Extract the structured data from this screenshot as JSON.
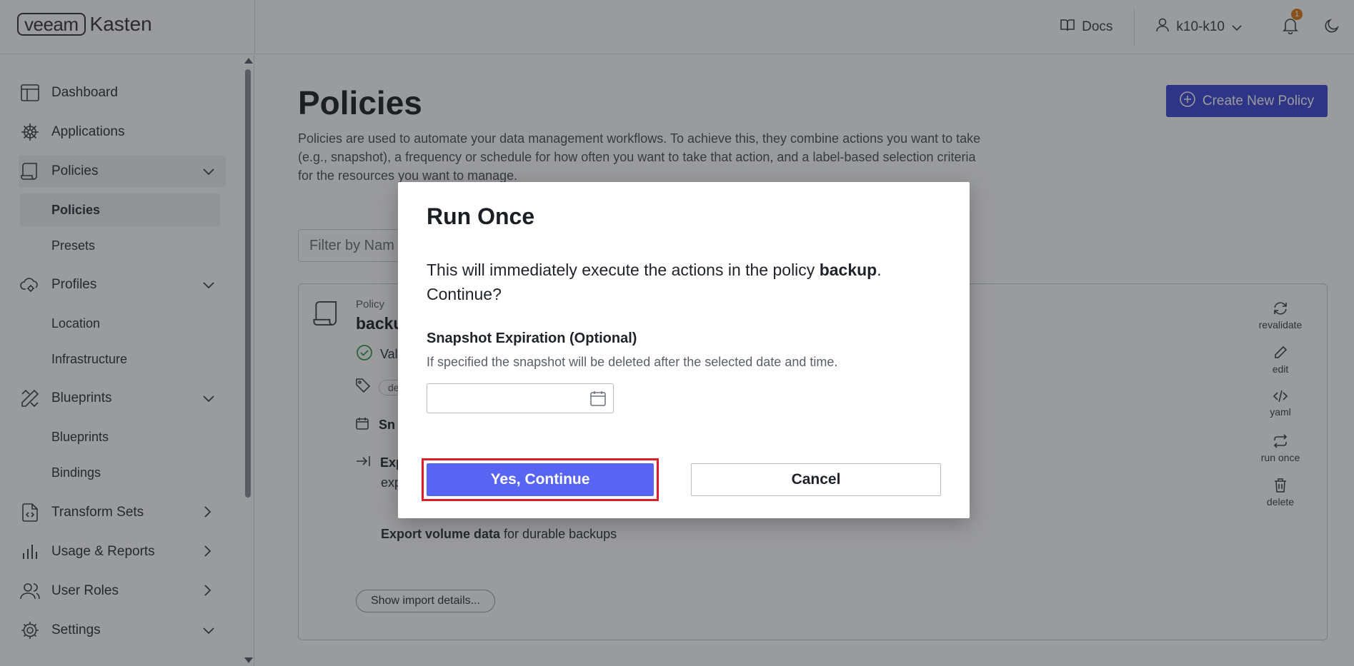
{
  "brand": {
    "part1": "veeam",
    "part2": "Kasten"
  },
  "topbar": {
    "docs_label": "Docs",
    "user_label": "k10-k10",
    "notification_count": "1"
  },
  "sidebar": {
    "items": [
      {
        "label": "Dashboard",
        "icon": "dashboard-icon"
      },
      {
        "label": "Applications",
        "icon": "helm-wheel-icon"
      },
      {
        "label": "Policies",
        "icon": "scroll-icon",
        "expanded": true
      },
      {
        "label": "Profiles",
        "icon": "cloud-gear-icon",
        "expanded": true
      },
      {
        "label": "Blueprints",
        "icon": "pencil-ruler-icon",
        "expanded": true
      },
      {
        "label": "Transform Sets",
        "icon": "file-code-icon"
      },
      {
        "label": "Usage & Reports",
        "icon": "bar-chart-icon"
      },
      {
        "label": "User Roles",
        "icon": "users-icon"
      },
      {
        "label": "Settings",
        "icon": "gear-icon",
        "expanded": true
      }
    ],
    "sub_policies": [
      "Policies",
      "Presets"
    ],
    "sub_profiles": [
      "Location",
      "Infrastructure"
    ],
    "sub_blueprints": [
      "Blueprints",
      "Bindings"
    ]
  },
  "main": {
    "title": "Policies",
    "description": "Policies are used to automate your data management workflows. To achieve this, they combine actions you want to take (e.g., snapshot), a frequency or schedule for how often you want to take that action, and a label-based selection criteria for the resources you want to manage.",
    "create_button": "Create New Policy",
    "filter_placeholder": "Filter by Nam",
    "card": {
      "kind": "Policy",
      "name": "backu",
      "status": "Val",
      "label_chip": "de",
      "snapshot_text": "Sn",
      "export_text": "Exp",
      "export_sub": "exp",
      "export_volume_bold": "Export volume data",
      "export_volume_rest": " for durable backups",
      "show_import": "Show import details..."
    },
    "actions": [
      {
        "label": "revalidate",
        "icon": "refresh-icon"
      },
      {
        "label": "edit",
        "icon": "pencil-icon"
      },
      {
        "label": "yaml",
        "icon": "code-icon"
      },
      {
        "label": "run once",
        "icon": "repeat-icon"
      },
      {
        "label": "delete",
        "icon": "trash-icon"
      }
    ]
  },
  "modal": {
    "title": "Run Once",
    "text_before": "This will immediately execute the actions in the policy ",
    "policy_name": "backup",
    "text_after": ". Continue?",
    "field_label": "Snapshot Expiration (Optional)",
    "field_help": "If specified the snapshot will be deleted after the selected date and time.",
    "date_value": "",
    "confirm_label": "Yes, Continue",
    "cancel_label": "Cancel"
  },
  "colors": {
    "primary": "#3b45d6",
    "confirm": "#5865f2",
    "highlight": "#e01b2a",
    "badge": "#e07b15",
    "valid": "#2e9e4f"
  }
}
